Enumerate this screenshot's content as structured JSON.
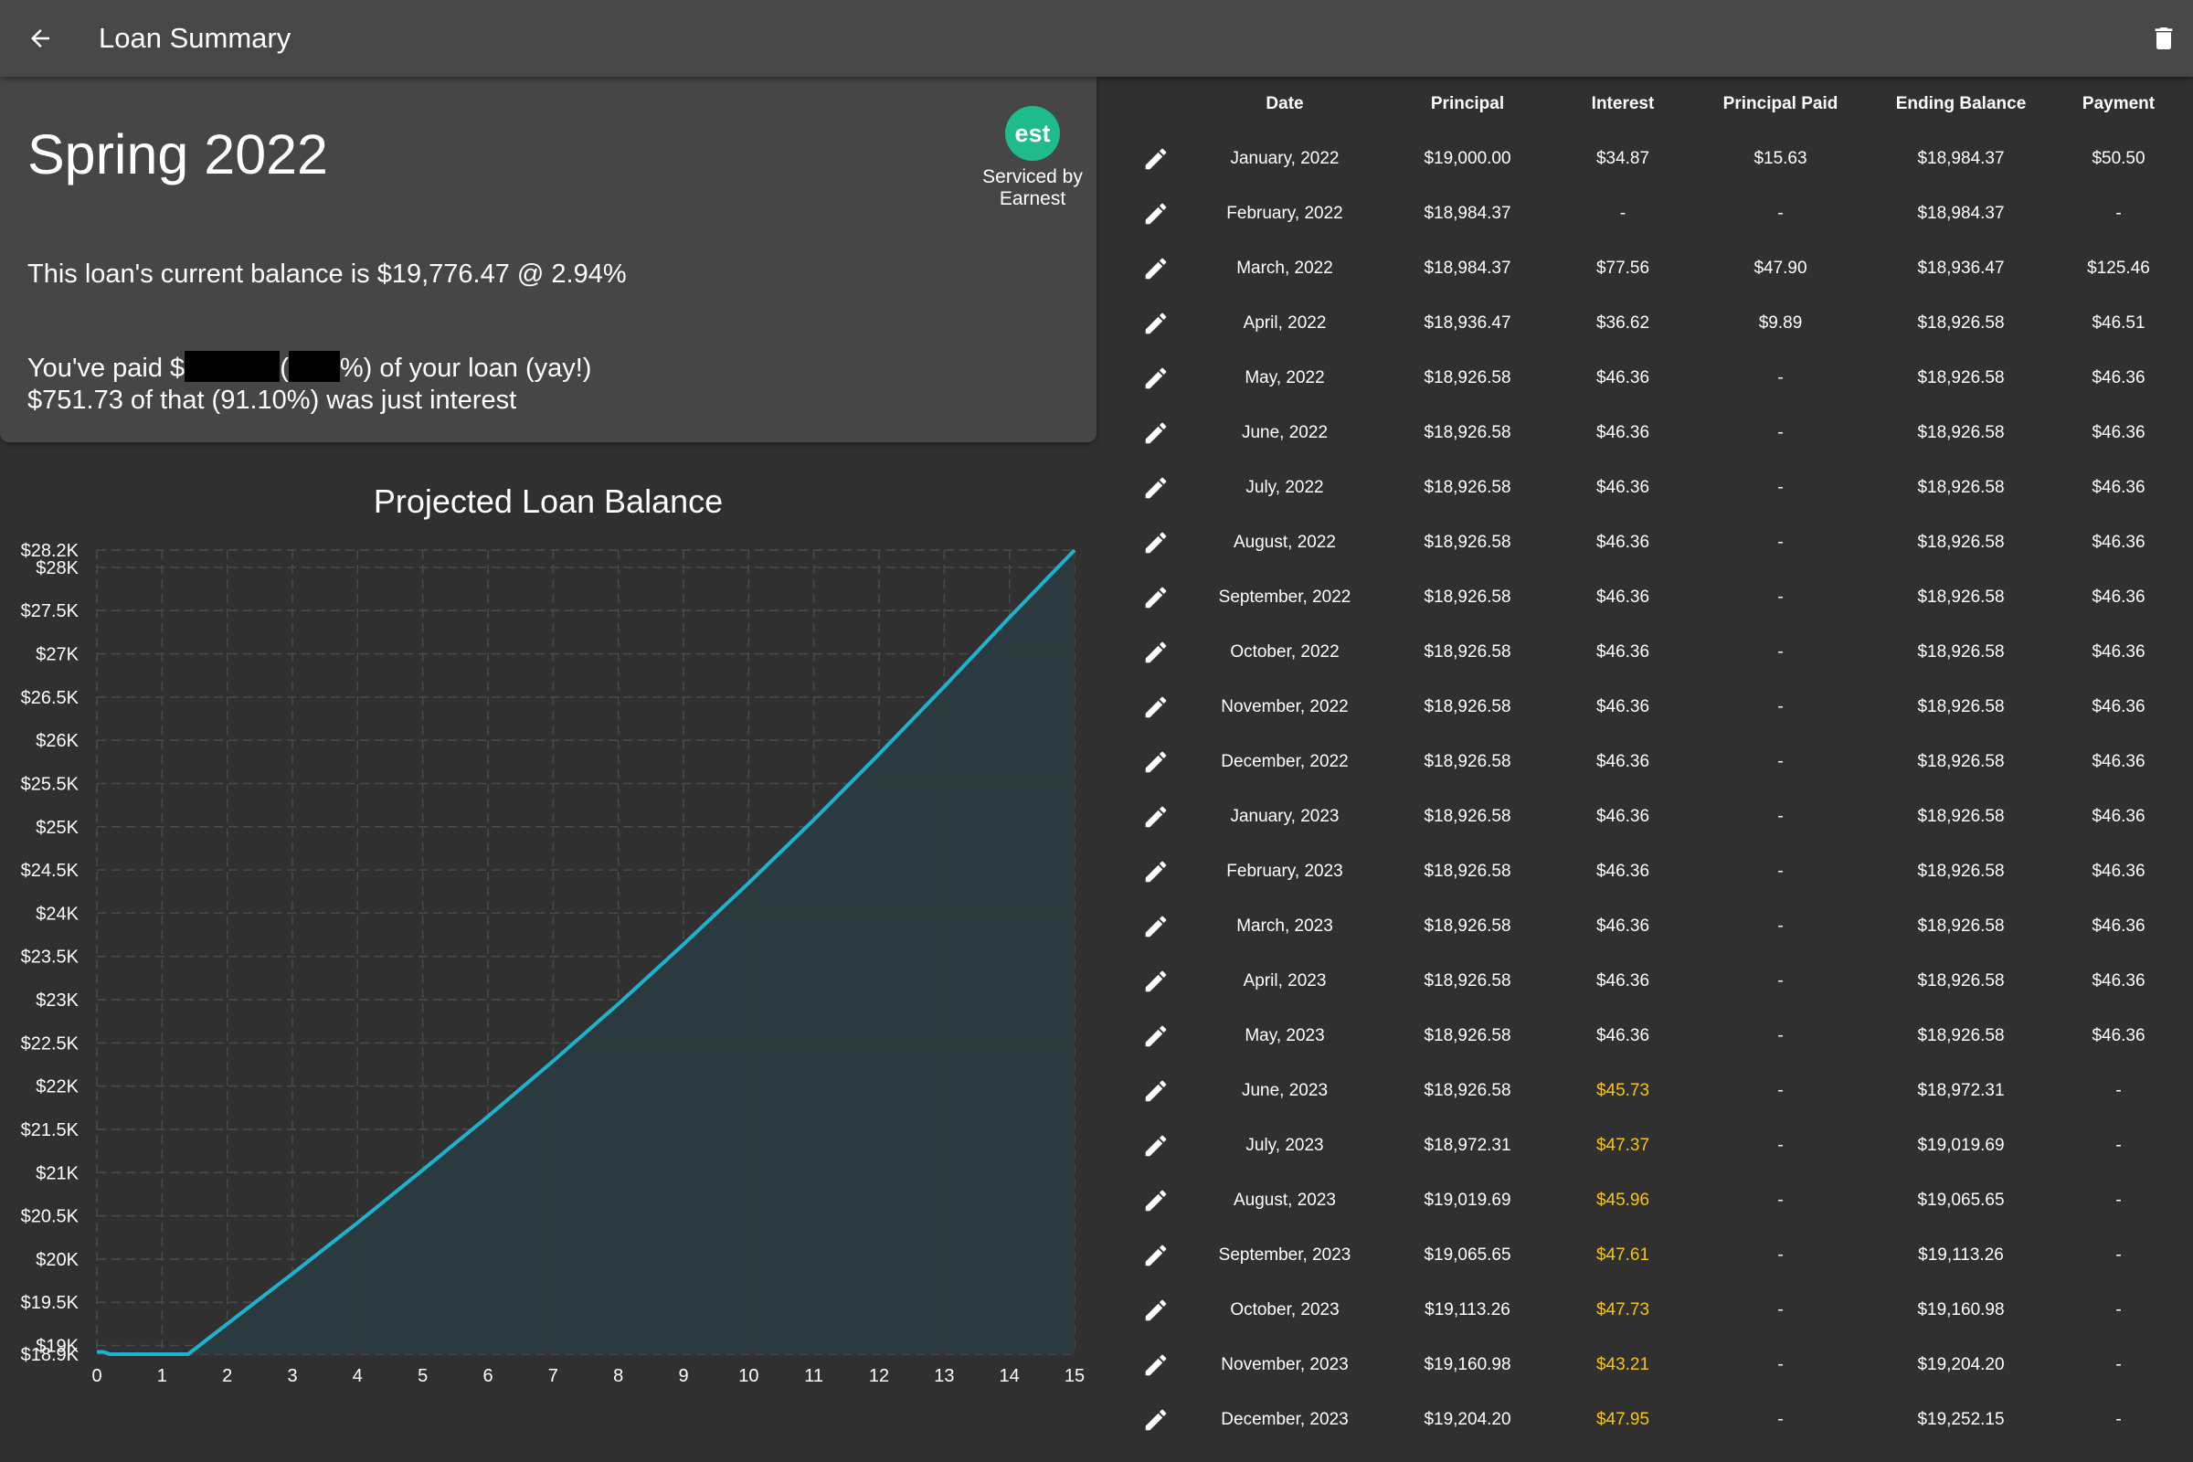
{
  "header": {
    "title": "Loan Summary",
    "back_icon": "arrow-left-icon",
    "delete_icon": "trash-icon"
  },
  "summary": {
    "loan_name": "Spring 2022",
    "servicer_logo_text": "est",
    "servicer_label_line1": "Serviced by",
    "servicer_label_line2": "Earnest",
    "balance_text": "This loan's current balance is $19,776.47 @ 2.94%",
    "paid_prefix": "You've paid $",
    "paid_middle": "(",
    "paid_suffix": "%) of your loan (yay!)",
    "interest_text": "$751.73 of that (91.10%) was just interest",
    "colors": {
      "servicer_logo": "#1ebc8c"
    }
  },
  "chart_data": {
    "type": "area",
    "title": "Projected Loan Balance",
    "xlabel": "",
    "ylabel": "",
    "x_ticks": [
      "0",
      "1",
      "2",
      "3",
      "4",
      "5",
      "6",
      "7",
      "8",
      "9",
      "10",
      "11",
      "12",
      "13",
      "14",
      "15"
    ],
    "y_ticks": [
      "$18.9K",
      "$19K",
      "$19.5K",
      "$20K",
      "$20.5K",
      "$21K",
      "$21.5K",
      "$22K",
      "$22.5K",
      "$23K",
      "$23.5K",
      "$24K",
      "$24.5K",
      "$25K",
      "$25.5K",
      "$26K",
      "$26.5K",
      "$27K",
      "$27.5K",
      "$28K",
      "$28.2K"
    ],
    "xlim": [
      0,
      15
    ],
    "ylim": [
      18900,
      28200
    ],
    "grid": true,
    "series": [
      {
        "x": [
          0,
          0.1,
          0.2,
          1.4,
          2,
          3,
          4,
          5,
          6,
          7,
          8,
          9,
          10,
          11,
          12,
          13,
          14,
          15
        ],
        "y": [
          18926.58,
          18926.58,
          18900,
          18900,
          19250,
          19830,
          20420,
          21030,
          21650,
          22290,
          22950,
          23640,
          24350,
          25080,
          25840,
          26620,
          27420,
          28200
        ]
      }
    ],
    "colors": {
      "line": "#1fb2cf",
      "fill": "#2b3b3f",
      "grid": "#4a4a4a"
    }
  },
  "table": {
    "columns": [
      "Date",
      "Principal",
      "Interest",
      "Principal Paid",
      "Ending Balance",
      "Payment"
    ],
    "rows": [
      {
        "date": "January, 2022",
        "principal": "$19,000.00",
        "interest": "$34.87",
        "principal_paid": "$15.63",
        "ending_balance": "$18,984.37",
        "payment": "$50.50",
        "projected": false
      },
      {
        "date": "February, 2022",
        "principal": "$18,984.37",
        "interest": "-",
        "principal_paid": "-",
        "ending_balance": "$18,984.37",
        "payment": "-",
        "projected": false
      },
      {
        "date": "March, 2022",
        "principal": "$18,984.37",
        "interest": "$77.56",
        "principal_paid": "$47.90",
        "ending_balance": "$18,936.47",
        "payment": "$125.46",
        "projected": false
      },
      {
        "date": "April, 2022",
        "principal": "$18,936.47",
        "interest": "$36.62",
        "principal_paid": "$9.89",
        "ending_balance": "$18,926.58",
        "payment": "$46.51",
        "projected": false
      },
      {
        "date": "May, 2022",
        "principal": "$18,926.58",
        "interest": "$46.36",
        "principal_paid": "-",
        "ending_balance": "$18,926.58",
        "payment": "$46.36",
        "projected": false
      },
      {
        "date": "June, 2022",
        "principal": "$18,926.58",
        "interest": "$46.36",
        "principal_paid": "-",
        "ending_balance": "$18,926.58",
        "payment": "$46.36",
        "projected": false
      },
      {
        "date": "July, 2022",
        "principal": "$18,926.58",
        "interest": "$46.36",
        "principal_paid": "-",
        "ending_balance": "$18,926.58",
        "payment": "$46.36",
        "projected": false
      },
      {
        "date": "August, 2022",
        "principal": "$18,926.58",
        "interest": "$46.36",
        "principal_paid": "-",
        "ending_balance": "$18,926.58",
        "payment": "$46.36",
        "projected": false
      },
      {
        "date": "September, 2022",
        "principal": "$18,926.58",
        "interest": "$46.36",
        "principal_paid": "-",
        "ending_balance": "$18,926.58",
        "payment": "$46.36",
        "projected": false
      },
      {
        "date": "October, 2022",
        "principal": "$18,926.58",
        "interest": "$46.36",
        "principal_paid": "-",
        "ending_balance": "$18,926.58",
        "payment": "$46.36",
        "projected": false
      },
      {
        "date": "November, 2022",
        "principal": "$18,926.58",
        "interest": "$46.36",
        "principal_paid": "-",
        "ending_balance": "$18,926.58",
        "payment": "$46.36",
        "projected": false
      },
      {
        "date": "December, 2022",
        "principal": "$18,926.58",
        "interest": "$46.36",
        "principal_paid": "-",
        "ending_balance": "$18,926.58",
        "payment": "$46.36",
        "projected": false
      },
      {
        "date": "January, 2023",
        "principal": "$18,926.58",
        "interest": "$46.36",
        "principal_paid": "-",
        "ending_balance": "$18,926.58",
        "payment": "$46.36",
        "projected": false
      },
      {
        "date": "February, 2023",
        "principal": "$18,926.58",
        "interest": "$46.36",
        "principal_paid": "-",
        "ending_balance": "$18,926.58",
        "payment": "$46.36",
        "projected": false
      },
      {
        "date": "March, 2023",
        "principal": "$18,926.58",
        "interest": "$46.36",
        "principal_paid": "-",
        "ending_balance": "$18,926.58",
        "payment": "$46.36",
        "projected": false
      },
      {
        "date": "April, 2023",
        "principal": "$18,926.58",
        "interest": "$46.36",
        "principal_paid": "-",
        "ending_balance": "$18,926.58",
        "payment": "$46.36",
        "projected": false
      },
      {
        "date": "May, 2023",
        "principal": "$18,926.58",
        "interest": "$46.36",
        "principal_paid": "-",
        "ending_balance": "$18,926.58",
        "payment": "$46.36",
        "projected": false
      },
      {
        "date": "June, 2023",
        "principal": "$18,926.58",
        "interest": "$45.73",
        "principal_paid": "-",
        "ending_balance": "$18,972.31",
        "payment": "-",
        "projected": true
      },
      {
        "date": "July, 2023",
        "principal": "$18,972.31",
        "interest": "$47.37",
        "principal_paid": "-",
        "ending_balance": "$19,019.69",
        "payment": "-",
        "projected": true
      },
      {
        "date": "August, 2023",
        "principal": "$19,019.69",
        "interest": "$45.96",
        "principal_paid": "-",
        "ending_balance": "$19,065.65",
        "payment": "-",
        "projected": true
      },
      {
        "date": "September, 2023",
        "principal": "$19,065.65",
        "interest": "$47.61",
        "principal_paid": "-",
        "ending_balance": "$19,113.26",
        "payment": "-",
        "projected": true
      },
      {
        "date": "October, 2023",
        "principal": "$19,113.26",
        "interest": "$47.73",
        "principal_paid": "-",
        "ending_balance": "$19,160.98",
        "payment": "-",
        "projected": true
      },
      {
        "date": "November, 2023",
        "principal": "$19,160.98",
        "interest": "$43.21",
        "principal_paid": "-",
        "ending_balance": "$19,204.20",
        "payment": "-",
        "projected": true
      },
      {
        "date": "December, 2023",
        "principal": "$19,204.20",
        "interest": "$47.95",
        "principal_paid": "-",
        "ending_balance": "$19,252.15",
        "payment": "-",
        "projected": true
      }
    ],
    "edit_icon": "pencil-icon",
    "colors": {
      "projected_interest": "#f5c419"
    }
  }
}
